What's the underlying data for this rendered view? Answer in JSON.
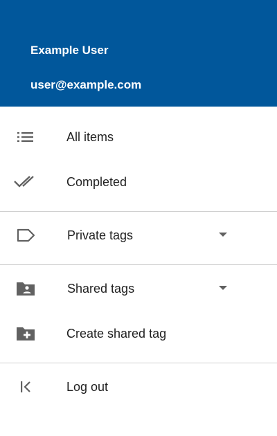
{
  "user": {
    "name": "Example User",
    "email": "user@example.com"
  },
  "colors": {
    "header_bg": "#01579b",
    "header_text": "#ffffff",
    "icon": "#616161",
    "text": "#212121",
    "divider": "#cfcfcf"
  },
  "menu": {
    "all_items": {
      "label": "All items",
      "icon": "list-icon"
    },
    "completed": {
      "label": "Completed",
      "icon": "double-check-icon"
    },
    "private_tags": {
      "label": "Private tags",
      "icon": "label-tag-icon",
      "expandable": true
    },
    "shared_tags": {
      "label": "Shared tags",
      "icon": "shared-folder-icon",
      "expandable": true
    },
    "create_shared_tag": {
      "label": "Create shared tag",
      "icon": "create-folder-icon"
    },
    "log_out": {
      "label": "Log out",
      "icon": "logout-icon"
    }
  }
}
